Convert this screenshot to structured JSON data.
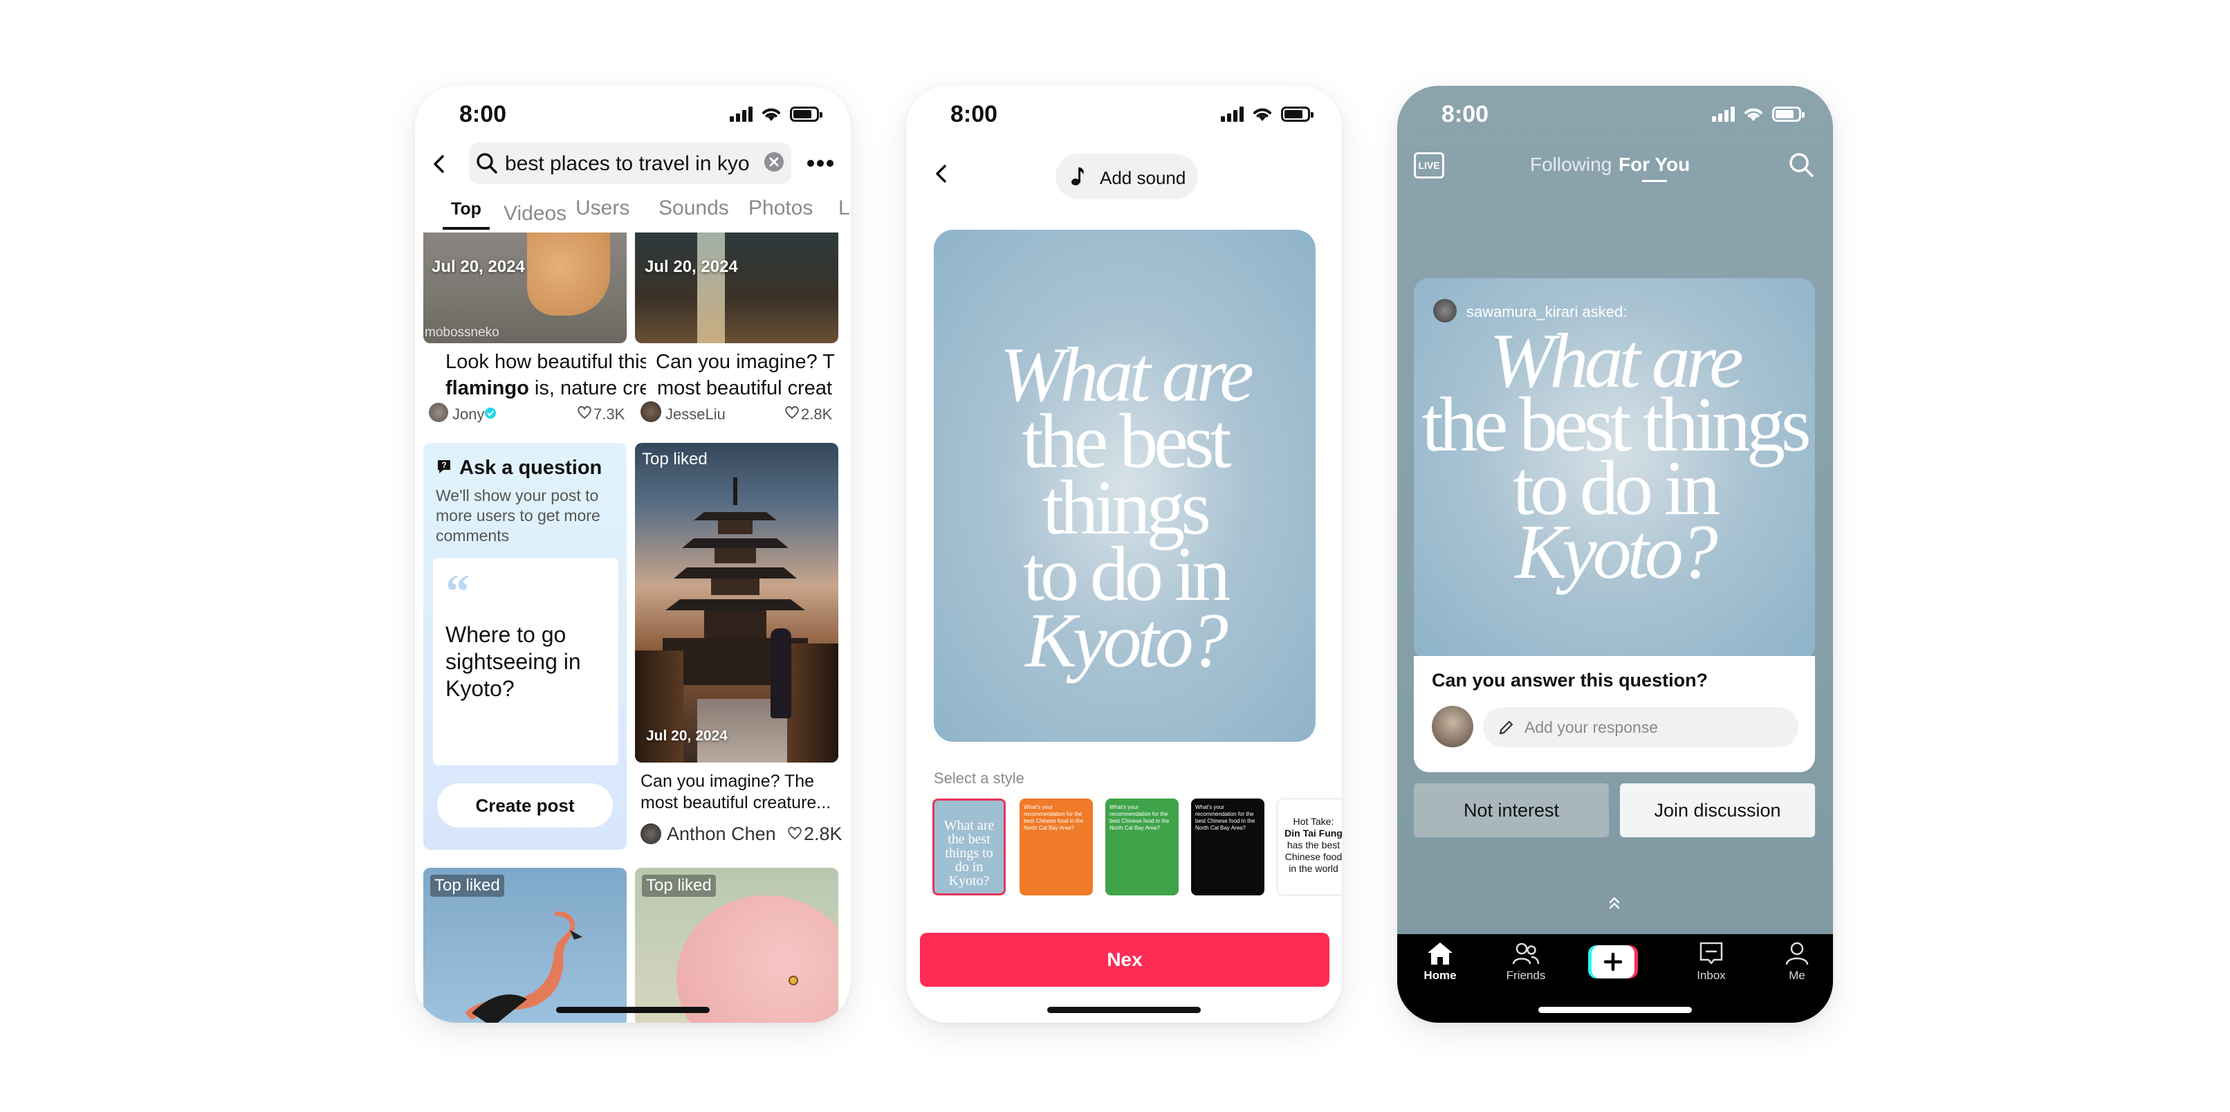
{
  "phone1": {
    "status": {
      "time": "8:00"
    },
    "search": {
      "value": "best places to travel in kyo"
    },
    "tabs": [
      "Top",
      "Videos",
      "Users",
      "Sounds",
      "Photos",
      "L"
    ],
    "cards": [
      {
        "date": "Jul 20, 2024",
        "watermark": "mobossneko",
        "title_line1": "Look how beautiful this",
        "title_line2_bold": "flamingo",
        "title_line2_rest": " is, nature cre...",
        "author": "Jony",
        "likes": "7.3K"
      },
      {
        "date": "Jul 20, 2024",
        "title_line1": "Can you imagine? T",
        "title_line2": "most beautiful creat",
        "author": "JesseLiu",
        "likes": "2.8K"
      }
    ],
    "ask": {
      "title": "Ask a question",
      "desc": "We'll show your post to more users to get more comments",
      "quote": "Where to go sightseeing in Kyoto?",
      "button": "Create post"
    },
    "pagoda": {
      "badge": "Top liked",
      "date": "Jul 20, 2024",
      "title": "Can you imagine? The most beautiful creature...",
      "author": "Anthon Chen",
      "likes": "2.8K"
    },
    "bottom_badges": [
      "Top liked",
      "Top liked"
    ]
  },
  "phone2": {
    "status": {
      "time": "8:00"
    },
    "add_sound": "Add sound",
    "card_text": {
      "line1": "What are",
      "line2": "the best things",
      "line3": "to do in",
      "line4": "Kyoto?"
    },
    "select_style": "Select a style",
    "styles": [
      {
        "text": "What are the best things to do in Kyoto?"
      },
      {
        "text": "What's your recommendation for the best Chinese food in the North Cal Bay Area?"
      },
      {
        "text": "What's your recommendation for the best Chinese food in the North Cal Bay Area?"
      },
      {
        "text": "What's your recommendation for the best Chinese food in the North Cal Bay Area?"
      },
      {
        "line1": "Hot Take:",
        "line2": "Din Tai Fung",
        "line3": "has the best Chinese food in the world"
      }
    ],
    "next_button": "Nex"
  },
  "phone3": {
    "status": {
      "time": "8:00"
    },
    "top_tabs": {
      "following": "Following",
      "for_you": "For You"
    },
    "live": "LIVE",
    "asked_by": "sawamura_kirari asked:",
    "card_text": {
      "line1": "What are",
      "line2": "the best things",
      "line3": "to do in",
      "line4": "Kyoto?"
    },
    "answer_prompt": "Can you answer this question?",
    "response_placeholder": "Add your response",
    "not_interested": "Not interest",
    "join_discussion": "Join discussion",
    "nav": [
      "Home",
      "Friends",
      "",
      "Inbox",
      "Me"
    ]
  },
  "colors": {
    "accent_red": "#fe2c55",
    "ask_bg": "#dff0fb",
    "dark_nav": "#000000"
  }
}
